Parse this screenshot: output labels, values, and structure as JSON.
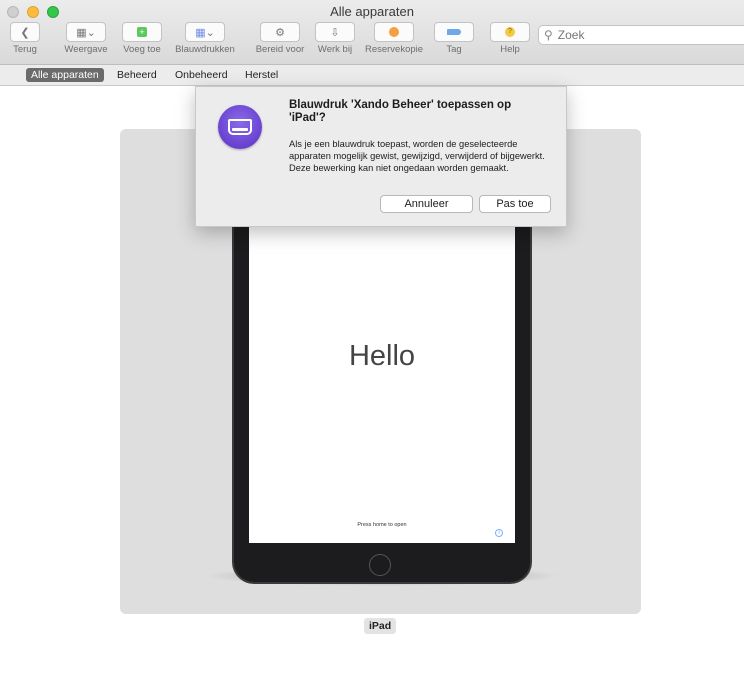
{
  "window": {
    "title": "Alle apparaten"
  },
  "toolbar": {
    "items": [
      {
        "label": "Terug",
        "icon": "chevron-left-icon"
      },
      {
        "label": "Weergave",
        "icon": "view-icon"
      },
      {
        "label": "Voeg toe",
        "icon": "add-icon"
      },
      {
        "label": "Blauwdrukken",
        "icon": "blueprint-icon"
      },
      {
        "label": "Bereid voor",
        "icon": "prepare-icon"
      },
      {
        "label": "Werk bij",
        "icon": "update-icon"
      },
      {
        "label": "Reservekopie",
        "icon": "backup-icon"
      },
      {
        "label": "Tag",
        "icon": "tag-icon"
      },
      {
        "label": "Help",
        "icon": "help-icon"
      }
    ],
    "search_placeholder": "Zoek"
  },
  "tabs": [
    "Alle apparaten",
    "Beheerd",
    "Onbeheerd",
    "Herstel"
  ],
  "device": {
    "name": "iPad",
    "screen_text": "Hello",
    "press_text": "Press home to open"
  },
  "dialog": {
    "title": "Blauwdruk 'Xando Beheer' toepassen op 'iPad'?",
    "message": "Als je een blauwdruk toepast, worden de geselecteerde apparaten mogelijk gewist, gewijzigd, verwijderd of bijgewerkt. Deze bewerking kan niet ongedaan worden gemaakt.",
    "cancel_label": "Annuleer",
    "apply_label": "Pas toe"
  },
  "colors": {
    "accent": "#6b6b6b",
    "app_icon": "#6a3fd8"
  }
}
